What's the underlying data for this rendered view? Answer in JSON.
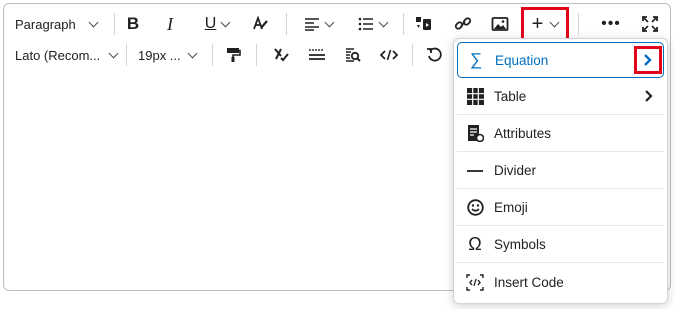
{
  "toolbar": {
    "row1": {
      "paragraph_label": "Paragraph"
    },
    "row2": {
      "font_label": "Lato (Recom...",
      "size_label": "19px ..."
    }
  },
  "menu": {
    "items": [
      {
        "label": "Equation",
        "icon": "sigma-icon",
        "has_submenu": true,
        "selected": true
      },
      {
        "label": "Table",
        "icon": "table-icon",
        "has_submenu": true
      },
      {
        "label": "Attributes",
        "icon": "attributes-icon"
      },
      {
        "label": "Divider",
        "icon": "divider-icon"
      },
      {
        "label": "Emoji",
        "icon": "emoji-icon"
      },
      {
        "label": "Symbols",
        "icon": "omega-icon"
      },
      {
        "label": "Insert Code",
        "icon": "code-icon"
      }
    ]
  },
  "colors": {
    "accent": "#006fbf",
    "highlight": "#e3061a"
  }
}
